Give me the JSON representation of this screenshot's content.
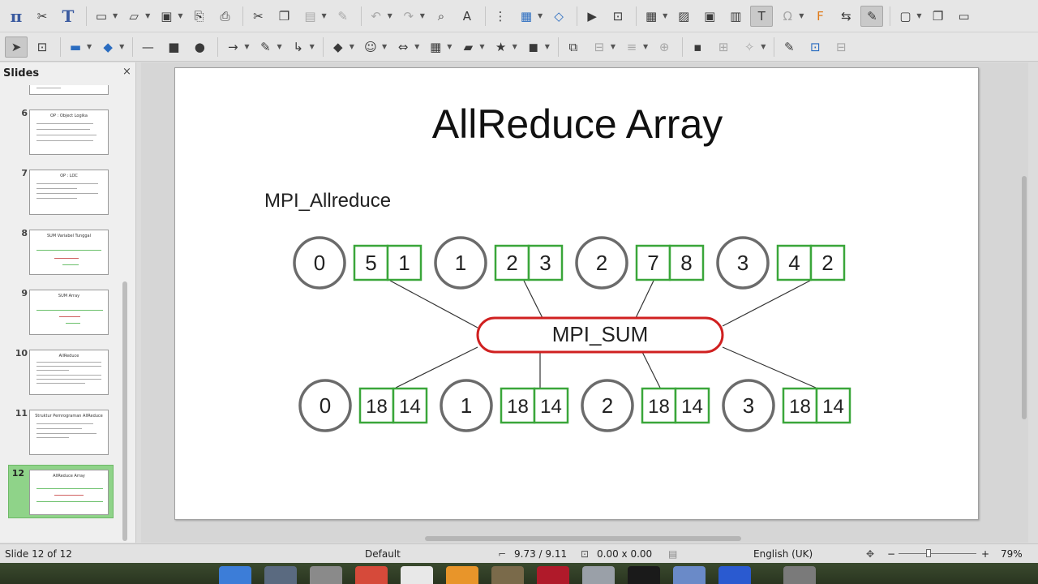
{
  "toolbar1": {
    "icons": [
      "math-icon",
      "scissors-icon",
      "format-icon",
      "new-icon",
      "open-icon",
      "save-icon",
      "export-pdf-icon",
      "print-icon",
      "cut-icon",
      "copy-icon",
      "paste-icon",
      "clone-icon",
      "undo-icon",
      "redo-icon",
      "find-icon",
      "spellcheck-icon",
      "grid-icon",
      "layout-icon",
      "master-icon",
      "start-show-icon",
      "present-icon",
      "table-icon",
      "image-icon",
      "media-icon",
      "chart-icon",
      "textbox-icon",
      "special-char-icon",
      "fontwork-icon",
      "transition-icon",
      "draw-icon",
      "comment-icon",
      "shape-icon",
      "close-icon"
    ]
  },
  "slides_panel": {
    "title": "Slides",
    "close": "×",
    "thumbs": [
      {
        "num": "",
        "title": ""
      },
      {
        "num": "6",
        "title": "OP : Object Logika"
      },
      {
        "num": "7",
        "title": "OP : LOC"
      },
      {
        "num": "8",
        "title": "SUM Variabel Tunggal"
      },
      {
        "num": "9",
        "title": "SUM Array"
      },
      {
        "num": "10",
        "title": "AllReduce"
      },
      {
        "num": "11",
        "title": "Struktur Pemrograman AllReduce"
      },
      {
        "num": "12",
        "title": "AllReduce Array"
      }
    ]
  },
  "slide": {
    "title": "AllReduce Array",
    "subtitle": "MPI_Allreduce",
    "op_label": "MPI_SUM",
    "top_ranks": [
      {
        "rank": "0",
        "values": [
          "5",
          "1"
        ]
      },
      {
        "rank": "1",
        "values": [
          "2",
          "3"
        ]
      },
      {
        "rank": "2",
        "values": [
          "7",
          "8"
        ]
      },
      {
        "rank": "3",
        "values": [
          "4",
          "2"
        ]
      }
    ],
    "bottom_ranks": [
      {
        "rank": "0",
        "values": [
          "18",
          "14"
        ]
      },
      {
        "rank": "1",
        "values": [
          "18",
          "14"
        ]
      },
      {
        "rank": "2",
        "values": [
          "18",
          "14"
        ]
      },
      {
        "rank": "3",
        "values": [
          "18",
          "14"
        ]
      }
    ],
    "colors": {
      "node_stroke": "#6b6b6b",
      "box_stroke": "#3aa63a",
      "op_stroke": "#d02020"
    }
  },
  "statusbar": {
    "slide_pos": "Slide 12 of 12",
    "master": "Default",
    "position": "9.73 / 9.11",
    "size": "0.00 x 0.00",
    "language": "English (UK)",
    "zoom_minus": "−",
    "zoom_plus": "+",
    "zoom": "79%"
  }
}
